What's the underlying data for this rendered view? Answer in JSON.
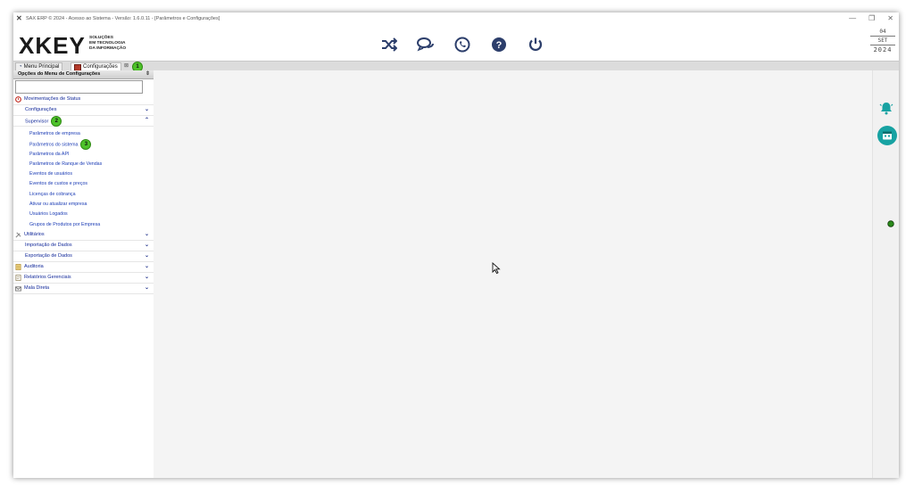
{
  "titlebar": {
    "title": "SAX ERP © 2024 - Acesso ao Sistema - Versão: 1.6.0.11 - [Parâmetros e Configurações]"
  },
  "logo": {
    "mark": "XKEY",
    "tag_line1": "SOLUÇÕES",
    "tag_line2": "EM TECNOLOGIA",
    "tag_line3": "DA INFORMAÇÃO"
  },
  "toolbar": {
    "icons": [
      "shuffle-icon",
      "chat-icon",
      "whatsapp-icon",
      "help-icon",
      "power-icon"
    ]
  },
  "date": {
    "day": "04",
    "month": "SET",
    "year": "2024"
  },
  "tabs": [
    {
      "label": "Menu Principal"
    },
    {
      "label": "Configurações"
    }
  ],
  "badges": {
    "one": "1",
    "two": "2",
    "three": "3"
  },
  "sidebar": {
    "header": "Opções do Menu de Configurações",
    "search_value": "",
    "items": {
      "status": "Movimentações de Status",
      "config": "Configurações",
      "supervisor": "Supervisor",
      "utilitarios": "Utilitários",
      "importacao": "Importação de Dados",
      "exportacao": "Exportação de Dados",
      "auditoria": "Auditoria",
      "relatorios": "Relatórios Gerenciais",
      "mala": "Mala Direta"
    },
    "supervisor_sub": [
      "Parâmetros de empresa",
      "Parâmetros do sistema",
      "Parâmetros da API",
      "Parâmetros de Ranque de Vendas",
      "Eventos de usuários",
      "Eventos de custos e preços",
      "Licenças de cobrança",
      "Ativar ou atualizar empresa",
      "Usuários Logados",
      "Grupos de Produtos por Empresa"
    ]
  },
  "colors": {
    "accent": "#12299a",
    "badge": "#4ec22a",
    "teal": "#17a2a2",
    "status_ok": "#2a8a1a"
  }
}
